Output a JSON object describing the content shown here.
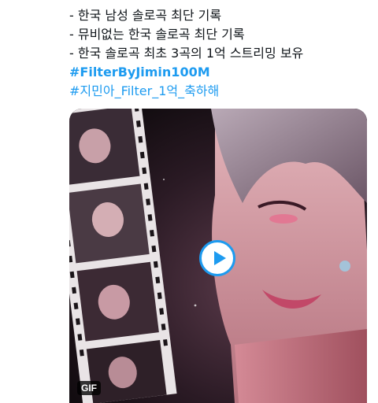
{
  "tweet": {
    "lines": [
      "- 한국 남성 솔로곡 최단 기록",
      "- 뮤비없는 한국 솔로곡 최단 기록",
      "- 한국 솔로곡 최초 3곡의 1억 스트리밍 보유"
    ],
    "hashtags": [
      "#FilterByJimin100M",
      "#지민아_Filter_1억_축하해"
    ]
  },
  "media": {
    "type": "gif",
    "badge": "GIF",
    "play_icon": "play-icon"
  },
  "colors": {
    "link": "#1d9bf0",
    "text": "#0f1419",
    "accent_pink": "#d8406a"
  }
}
